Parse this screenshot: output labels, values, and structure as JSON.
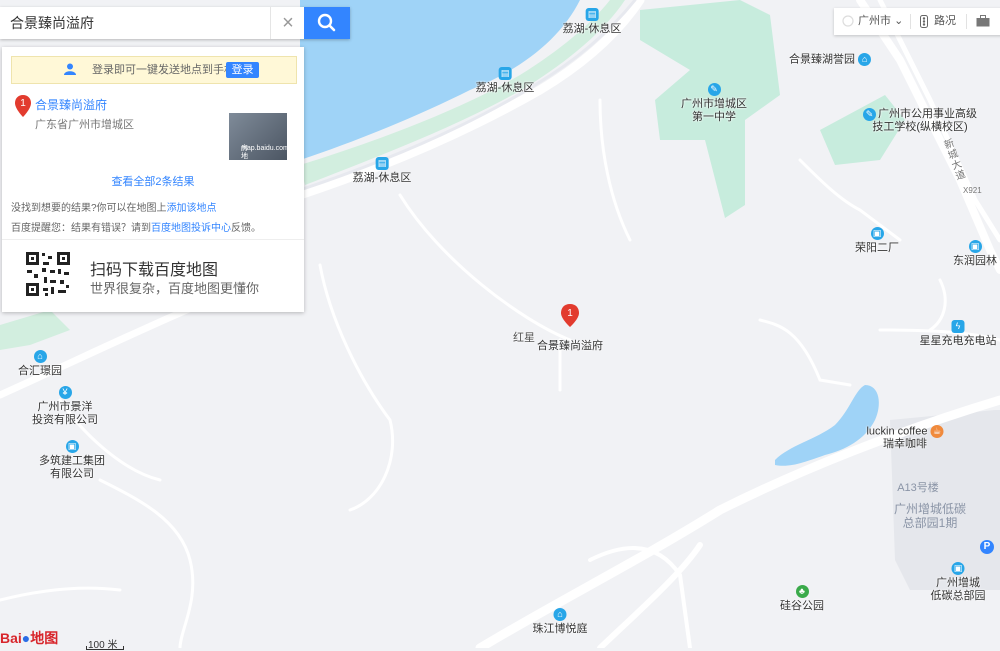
{
  "search": {
    "query": "合景臻尚溢府",
    "clear_icon": "×"
  },
  "login_bar": {
    "text": "登录即可一键发送地点到手机",
    "button": "登录"
  },
  "result": {
    "index": "1",
    "name": "合景臻尚溢府",
    "address": "广东省广州市增城区",
    "thumb_line1": "房地产",
    "thumb_line2": "map.baidu.com"
  },
  "view_all": "查看全部2条结果",
  "not_found": {
    "prefix": "没找到想要的结果?你可以在地图上",
    "link": "添加该地点"
  },
  "tip": {
    "prefix": "百度提醒您：结果有错误？请到",
    "link": "百度地图投诉中心",
    "suffix": "反馈。"
  },
  "qr": {
    "title": "扫码下载百度地图",
    "subtitle": "世界很复杂，百度地图更懂你"
  },
  "topbar": {
    "city": "广州市",
    "route": "路况"
  },
  "map_marker": {
    "index": "1",
    "name": "合景臻尚溢府",
    "nearby": "红星"
  },
  "pois": [
    {
      "name": "荔湖-休息区"
    },
    {
      "name": "荔湖-休息区"
    },
    {
      "name": "荔湖-休息区"
    },
    {
      "name": "合景臻湖誉园"
    },
    {
      "name": "广州市增城区",
      "name2": "第一中学"
    },
    {
      "name": "广州市公用事业高级",
      "name2": "技工学校(纵横校区)"
    },
    {
      "name": "荣阳二厂"
    },
    {
      "name": "东润园林"
    },
    {
      "name": "星星充电充电站"
    },
    {
      "name": "合汇璟园"
    },
    {
      "name": "广州市景洋",
      "name2": "投资有限公司"
    },
    {
      "name": "多筑建工集团",
      "name2": "有限公司"
    },
    {
      "name": "luckin coffee",
      "name2": "瑞幸咖啡"
    },
    {
      "name": "广州增城",
      "name2": "低碳总部园"
    },
    {
      "name": "硅谷公园"
    },
    {
      "name": "珠江博悦庭"
    }
  ],
  "area_labels": [
    {
      "text": "A13号楼"
    },
    {
      "text": "广州增城低碳",
      "text2": "总部园1期"
    }
  ],
  "road_label": {
    "name": "新城大道",
    "code": "X921"
  },
  "scale": "100 米",
  "logo": {
    "a": "Bai",
    "b": "地图"
  },
  "colors": {
    "water": "#9fd3f7",
    "green": "#c7ecdd",
    "road": "#ffffff",
    "accent": "#3385ff",
    "marker": "#e23b2e"
  }
}
